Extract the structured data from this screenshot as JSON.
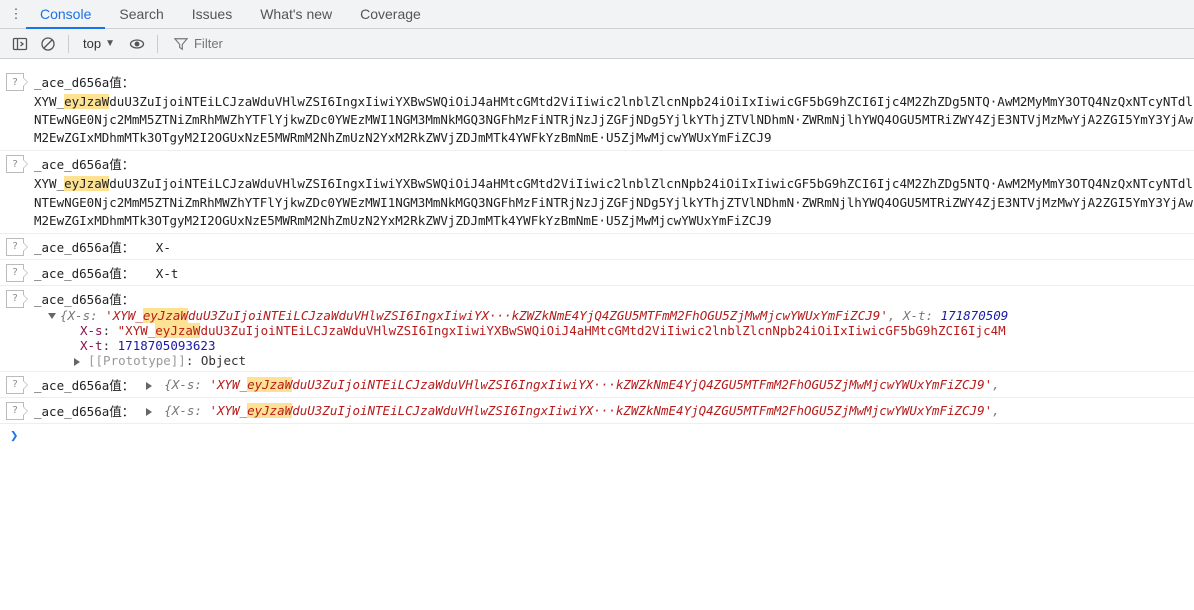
{
  "tabs": {
    "items": [
      "Console",
      "Search",
      "Issues",
      "What's new",
      "Coverage"
    ],
    "active_index": 0
  },
  "toolbar": {
    "context": "top",
    "filter_placeholder": "Filter"
  },
  "logs": [
    {
      "label": "_ace_d656a值：",
      "type": "block",
      "prefix": "XYW_",
      "highlight": "eyJzaW",
      "rest": "duU3ZuIjoiNTEiLCJzaWduVHlwZSI6IngxIiwiYXBwSWQiOiJ4aHMtcGMtd2ViIiwic2lnblZlcnNpb24iOiIxIiwicGF5bG9hZCI6Ijc4M2ZhZDg5NTQ·AwM2MyMmY3OTQ4NzQxNTcyNTdlNTEwNGE0Njc2MmM5ZTNiZmRhMWZhYTFlYjkwZDc0YWEzMWI1NGM3MmNkMGQ3NGFhMzFiNTRjNzJjZGFjNDg5YjlkYThjZTVlNDhmN·ZWRmNjlhYWQ4OGU5MTRiZWY4ZjE3NTVjMzMwYjA2ZGI5YmY3YjAwM2EwZGIxMDhmMTk3OTgyM2I2OGUxNzE5MWRmM2NhZmUzN2YxM2RkZWVjZDJmMTk4YWFkYzBmNmE·U5ZjMwMjcwYWUxYmFiZCJ9"
    },
    {
      "label": "_ace_d656a值：",
      "type": "block",
      "prefix": "XYW_",
      "highlight": "eyJzaW",
      "rest": "duU3ZuIjoiNTEiLCJzaWduVHlwZSI6IngxIiwiYXBwSWQiOiJ4aHMtcGMtd2ViIiwic2lnblZlcnNpb24iOiIxIiwicGF5bG9hZCI6Ijc4M2ZhZDg5NTQ·AwM2MyMmY3OTQ4NzQxNTcyNTdlNTEwNGE0Njc2MmM5ZTNiZmRhMWZhYTFlYjkwZDc0YWEzMWI1NGM3MmNkMGQ3NGFhMzFiNTRjNzJjZGFjNDg5YjlkYThjZTVlNDhmN·ZWRmNjlhYWQ4OGU5MTRiZWY4ZjE3NTVjMzMwYjA2ZGI5YmY3YjAwM2EwZGIxMDhmMTk3OTgyM2I2OGUxNzE5MWRmM2NhZmUzN2YxM2RkZWVjZDJmMTk4YWFkYzBmNmE·U5ZjMwMjcwYWUxYmFiZCJ9"
    },
    {
      "label": "_ace_d656a值：",
      "type": "inline",
      "value": "X-"
    },
    {
      "label": "_ace_d656a值：",
      "type": "inline",
      "value": "X-t"
    },
    {
      "label": "_ace_d656a值：",
      "type": "object_expanded",
      "summary_key": "X-s",
      "summary_prefix": "'XYW_",
      "summary_highlight": "eyJzaW",
      "summary_mid": "duU3ZuIjoiNTEiLCJzaWduVHlwZSI6IngxIiwiYX···kZWZkNmE4YjQ4ZGU5MTFmM2FhOGU5ZjMwMjcwYWUxYmFiZCJ9'",
      "summary_tail_key": "X-t",
      "summary_tail_val": "171870509",
      "xs_key": "X-s",
      "xs_prefix": "\"XYW_",
      "xs_highlight": "eyJzaW",
      "xs_rest": "duU3ZuIjoiNTEiLCJzaWduVHlwZSI6IngxIiwiYXBwSWQiOiJ4aHMtcGMtd2ViIiwic2lnblZlcnNpb24iOiIxIiwicGF5bG9hZCI6Ijc4M",
      "xt_key": "X-t",
      "xt_val": "1718705093623",
      "proto_label": "[[Prototype]]",
      "proto_val": "Object"
    },
    {
      "label": "_ace_d656a值：",
      "type": "object_collapsed",
      "summary_key": "X-s",
      "summary_prefix": "'XYW_",
      "summary_highlight": "eyJzaW",
      "summary_mid": "duU3ZuIjoiNTEiLCJzaWduVHlwZSI6IngxIiwiYX···kZWZkNmE4YjQ4ZGU5MTFmM2FhOGU5ZjMwMjcwYWUxYmFiZCJ9'",
      "tail": ","
    },
    {
      "label": "_ace_d656a值：",
      "type": "object_collapsed",
      "summary_key": "X-s",
      "summary_prefix": "'XYW_",
      "summary_highlight": "eyJzaW",
      "summary_mid": "duU3ZuIjoiNTEiLCJzaWduVHlwZSI6IngxIiwiYX···kZWZkNmE4YjQ4ZGU5MTFmM2FhOGU5ZjMwMjcwYWUxYmFiZCJ9'",
      "tail": ","
    }
  ],
  "prompt": "❯"
}
